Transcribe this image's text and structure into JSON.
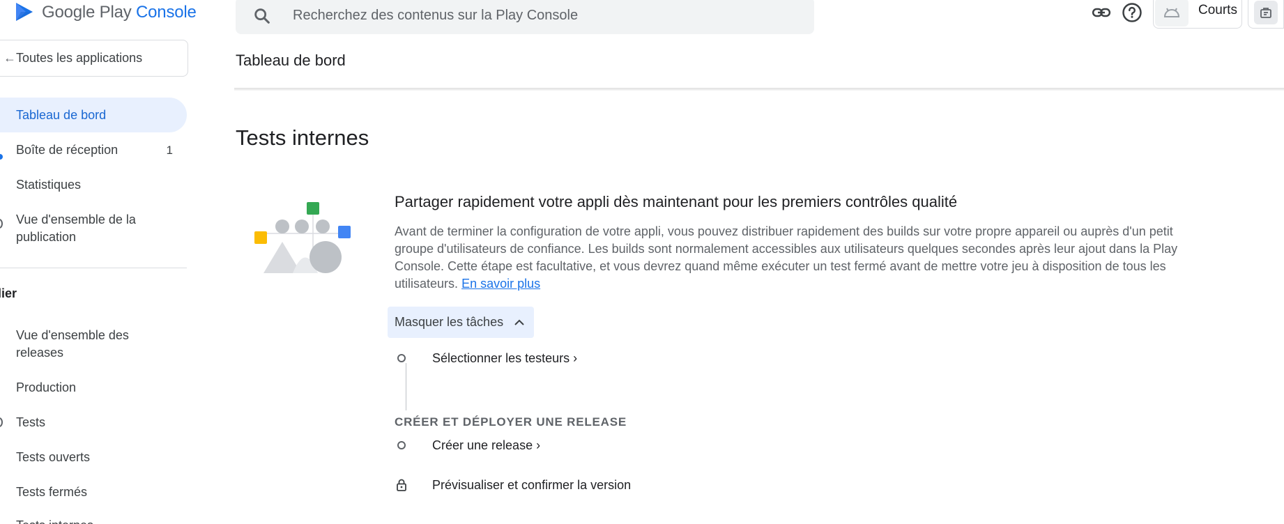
{
  "header": {
    "logo_google": "Google Play",
    "logo_console": "Console",
    "search_placeholder": "Recherchez des contenus sur la Play Console",
    "app_chip_name": "Courts"
  },
  "sidebar": {
    "all_apps": "Toutes les applications",
    "items": [
      {
        "label": "Tableau de bord"
      },
      {
        "label": "Boîte de réception",
        "badge": "1"
      },
      {
        "label": "Statistiques"
      },
      {
        "label": "Vue d'ensemble de la publication"
      }
    ],
    "section_label": "plier",
    "release_items": [
      {
        "label": "Vue d'ensemble des releases"
      },
      {
        "label": "Production"
      },
      {
        "label": "Tests"
      },
      {
        "label": "Tests ouverts"
      },
      {
        "label": "Tests fermés"
      },
      {
        "label": "Tests internes"
      }
    ]
  },
  "main": {
    "page_title": "Tableau de bord",
    "section_title": "Tests internes",
    "card": {
      "title": "Partager rapidement votre appli dès maintenant pour les premiers contrôles qualité",
      "description": "Avant de terminer la configuration de votre appli, vous pouvez distribuer rapidement des builds sur votre propre appareil ou auprès d'un petit groupe d'utilisateurs de confiance. Les builds sont normalement accessibles aux utilisateurs quelques secondes après leur ajout dans la Play Console. Cette étape est facultative, et vous devrez quand même exécuter un test fermé avant de mettre votre jeu à disposition de tous les utilisateurs.",
      "learn_more": "En savoir plus",
      "toggle_label": "Masquer les tâches"
    },
    "tasks": {
      "select_testers": "Sélectionner les testeurs",
      "group_label": "CRÉER ET DÉPLOYER UNE RELEASE",
      "create_release": "Créer une release",
      "preview_confirm": "Prévisualiser et confirmer la version"
    }
  },
  "colors": {
    "accent": "#1a73e8",
    "active_nav_bg": "#e8f0fe",
    "illus_green": "#34a853",
    "illus_yellow": "#fbbc04",
    "illus_blue": "#4285f4"
  }
}
